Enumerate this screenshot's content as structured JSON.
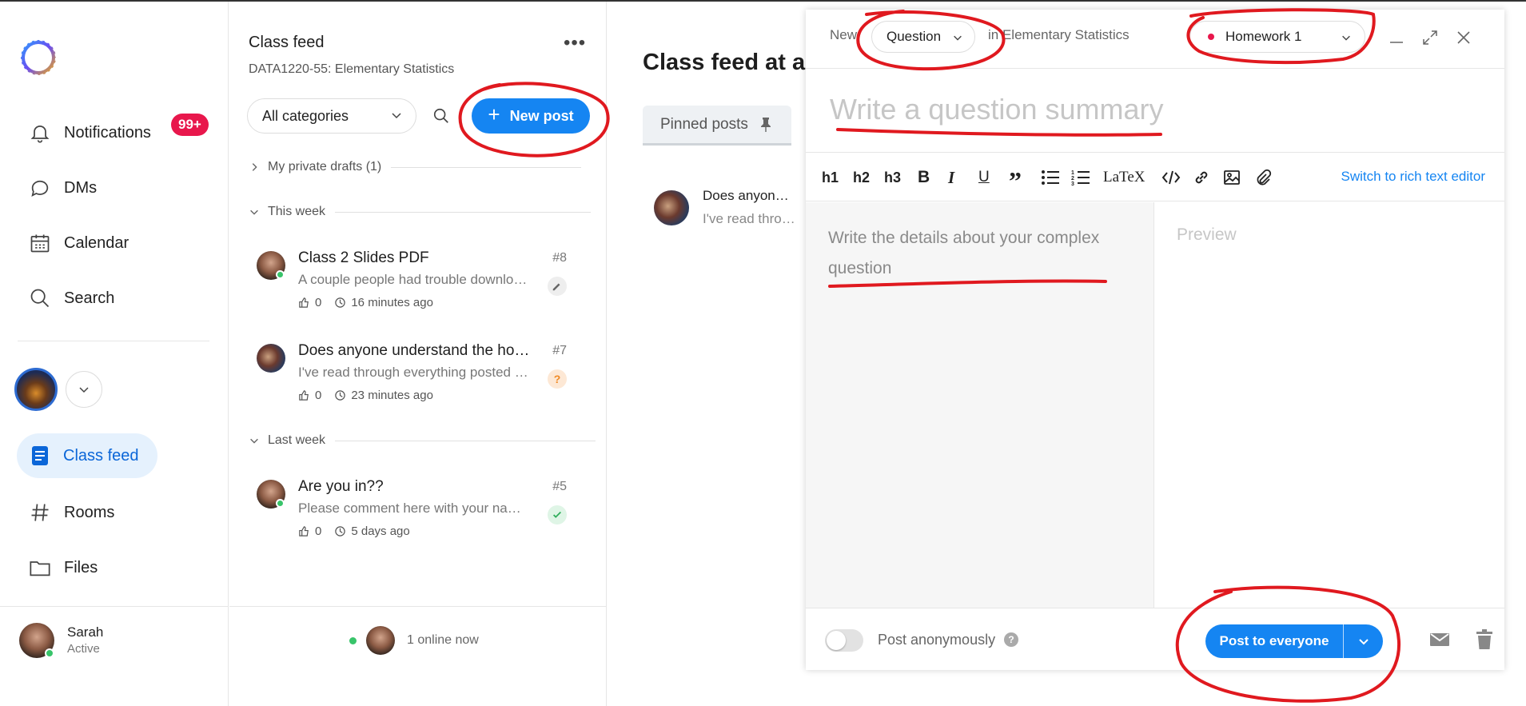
{
  "nav": {
    "notifications": "Notifications",
    "notifications_badge": "99+",
    "dms": "DMs",
    "calendar": "Calendar",
    "search": "Search",
    "class_feed": "Class feed",
    "rooms": "Rooms",
    "files": "Files",
    "user_name": "Sarah",
    "user_status": "Active"
  },
  "feed": {
    "title": "Class feed",
    "course": "DATA1220-55: Elementary Statistics",
    "category_select": "All categories",
    "new_post": "New post",
    "drafts": "My private drafts (1)",
    "this_week": "This week",
    "last_week": "Last week",
    "posts": [
      {
        "title": "Class 2 Slides PDF",
        "num": "#8",
        "snippet": "A couple people had trouble downlo…",
        "likes": "0",
        "time": "16 minutes ago"
      },
      {
        "title": "Does anyone understand the ho…",
        "num": "#7",
        "snippet": "I've read through everything posted …",
        "likes": "0",
        "time": "23 minutes ago"
      },
      {
        "title": "Are you in??",
        "num": "#5",
        "snippet": "Please comment here with your na…",
        "likes": "0",
        "time": "5 days ago"
      }
    ],
    "online": "1 online now"
  },
  "main": {
    "title": "Class feed at a",
    "pinned": "Pinned posts",
    "mini_title": "Does anyon…",
    "mini_snip": "I've read thro…"
  },
  "editor": {
    "new_label": "New",
    "type": "Question",
    "in_label": "in Elementary Statistics",
    "folder": "Homework 1",
    "summary_placeholder": "Write a question summary",
    "toolbar": [
      "h1",
      "h2",
      "h3",
      "B",
      "I",
      "U",
      "”",
      "LaTeX"
    ],
    "rich_text": "Switch to rich text editor",
    "details_placeholder": "Write the details about your complex question",
    "preview": "Preview",
    "anonymous": "Post anonymously",
    "post_button": "Post to everyone"
  },
  "colors": {
    "accent": "#1585f2",
    "badge": "#e8174c",
    "annotation": "#e0191f"
  }
}
